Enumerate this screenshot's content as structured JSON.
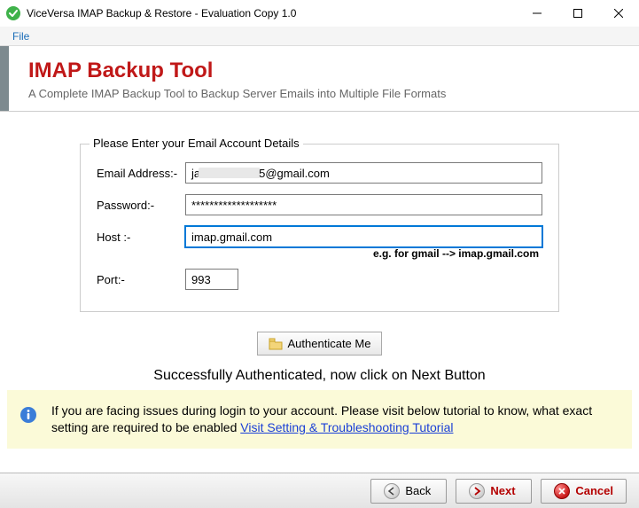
{
  "window": {
    "title": "ViceVersa IMAP Backup & Restore - Evaluation Copy 1.0"
  },
  "menu": {
    "file": "File"
  },
  "header": {
    "title_part1": "IMAP ",
    "title_part2": "Backup Tool",
    "subtitle": "A Complete IMAP Backup Tool to Backup Server Emails into Multiple File Formats"
  },
  "group": {
    "legend": "Please Enter your Email Account Details",
    "email_label": "Email Address:-",
    "email_value_prefix": "ja",
    "email_value_suffix": "5@gmail.com",
    "password_label": "Password:-",
    "password_value": "*******************",
    "host_label": "Host :-",
    "host_value": "imap.gmail.com",
    "host_hint": "e.g. for gmail -->   imap.gmail.com",
    "port_label": "Port:-",
    "port_value": "993"
  },
  "buttons": {
    "authenticate": "Authenticate Me",
    "back": "Back",
    "next": "Next",
    "cancel": "Cancel"
  },
  "status": "Successfully Authenticated, now click on Next Button",
  "info": {
    "text_before": "If you are facing issues during login to your account. Please visit below tutorial to know, what exact setting are required to be enabled   ",
    "link": "Visit Setting & Troubleshooting Tutorial"
  }
}
